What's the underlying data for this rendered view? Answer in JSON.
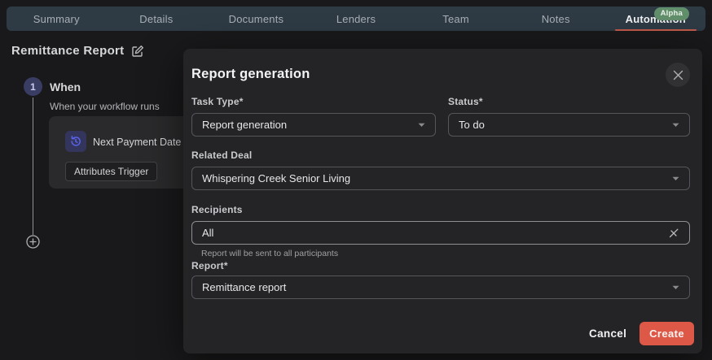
{
  "nav": {
    "tabs": [
      {
        "label": "Summary",
        "active": false
      },
      {
        "label": "Details",
        "active": false
      },
      {
        "label": "Documents",
        "active": false
      },
      {
        "label": "Lenders",
        "active": false
      },
      {
        "label": "Team",
        "active": false
      },
      {
        "label": "Notes",
        "active": false
      },
      {
        "label": "Automation",
        "active": true
      }
    ],
    "alpha_badge": "Alpha"
  },
  "workflow": {
    "title": "Remittance Report",
    "step_number": "1",
    "step_title": "When",
    "step_subtitle": "When your workflow runs",
    "trigger_name": "Next Payment Date",
    "trigger_tag": "Attributes Trigger"
  },
  "modal": {
    "title": "Report generation",
    "fields": {
      "task_type": {
        "label": "Task Type*",
        "value": "Report generation"
      },
      "status": {
        "label": "Status*",
        "value": "To do"
      },
      "related_deal": {
        "label": "Related Deal",
        "value": "Whispering Creek Senior Living"
      },
      "recipients": {
        "label": "Recipients",
        "value": "All",
        "helper": "Report will be sent to all participants"
      },
      "report": {
        "label": "Report*",
        "value": "Remittance report"
      }
    },
    "cancel_label": "Cancel",
    "create_label": "Create"
  },
  "colors": {
    "accent": "#dd5847",
    "tab_underline": "#c05a4a",
    "alpha_badge_bg": "#628f6b",
    "trigger_icon": "#5964e6",
    "navbar_bg": "#2e3a44",
    "modal_bg": "#242426",
    "page_bg": "#19191b"
  }
}
